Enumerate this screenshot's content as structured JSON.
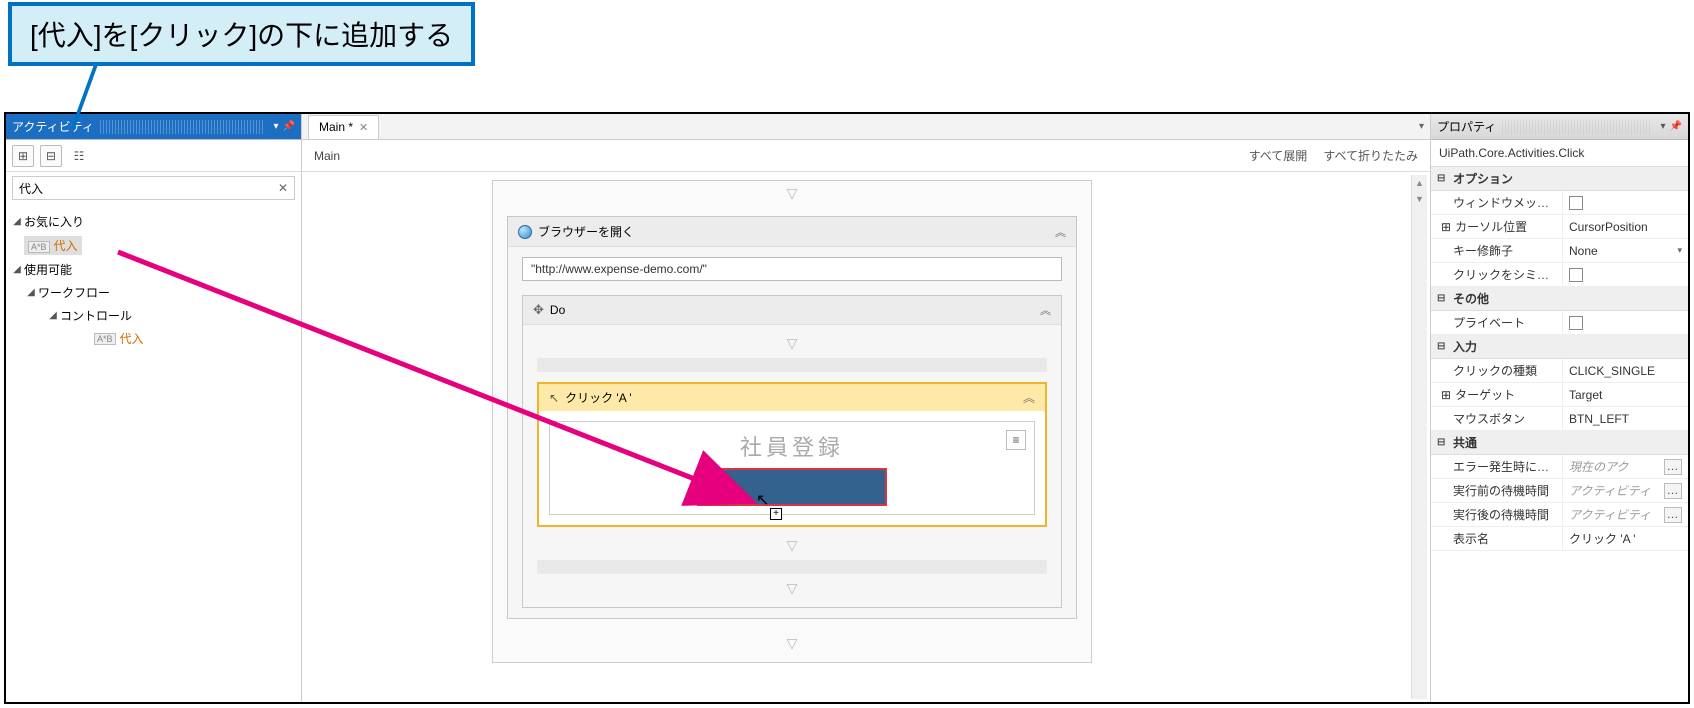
{
  "callout": "[代入]を[クリック]の下に追加する",
  "panels": {
    "activities_title": "アクティビティ",
    "properties_title": "プロパティ"
  },
  "search": {
    "value": "代入"
  },
  "tree": {
    "favorites": "お気に入り",
    "assign": "代入",
    "available": "使用可能",
    "workflow": "ワークフロー",
    "control": "コントロール"
  },
  "tab": {
    "label": "Main *",
    "breadcrumb": "Main",
    "expand_all": "すべて展開",
    "collapse_all": "すべて折りたたみ"
  },
  "wf": {
    "open_browser": "ブラウザーを開く",
    "url": "\"http://www.expense-demo.com/\"",
    "do": "Do",
    "click": "クリック 'A '",
    "placeholder_title": "社員登録"
  },
  "props": {
    "selected": "UiPath.Core.Activities.Click",
    "cat_option": "オプション",
    "send_window_msg": "ウィンドウメッセージを送信",
    "cursor_pos": "カーソル位置",
    "cursor_pos_val": "CursorPosition",
    "key_modifier": "キー修飾子",
    "key_modifier_val": "None",
    "simulate_click": "クリックをシミュレート",
    "cat_other": "その他",
    "private": "プライベート",
    "cat_input": "入力",
    "click_type": "クリックの種類",
    "click_type_val": "CLICK_SINGLE",
    "target": "ターゲット",
    "target_val": "Target",
    "mouse_btn": "マウスボタン",
    "mouse_btn_val": "BTN_LEFT",
    "cat_common": "共通",
    "continue_on_error": "エラー発生時に実行を継...",
    "continue_on_error_val": "現在のアク",
    "delay_before": "実行前の待機時間",
    "delay_before_val": "アクティビティ",
    "delay_after": "実行後の待機時間",
    "delay_after_val": "アクティビティ",
    "display_name": "表示名",
    "display_name_val": "クリック 'A '"
  }
}
